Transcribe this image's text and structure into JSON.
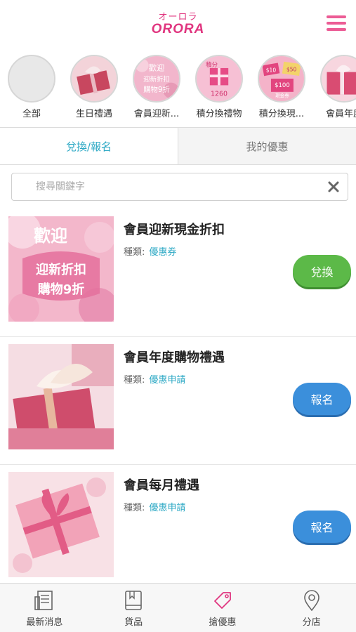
{
  "header": {
    "logo_kana": "オーロラ",
    "logo_main": "ORORA"
  },
  "categories": [
    {
      "label": "全部"
    },
    {
      "label": "生日禮遇"
    },
    {
      "label": "會員迎新..."
    },
    {
      "label": "積分換禮物"
    },
    {
      "label": "積分換現..."
    },
    {
      "label": "會員年度"
    }
  ],
  "category_thumbs": {
    "welcome": {
      "line1": "歡迎",
      "line2": "迎新折扣",
      "line3": "購物9折"
    },
    "points_gift": {
      "line1": "積分",
      "line2": "1260"
    },
    "points_cash": {
      "line1": "$10",
      "line2": "$50",
      "line3": "$100",
      "line4": "現金券"
    }
  },
  "tabs": {
    "redeem": "兌換/報名",
    "my_offers": "我的優惠"
  },
  "search": {
    "placeholder": "搜尋關鍵字"
  },
  "offers": [
    {
      "title": "會員迎新現金折扣",
      "type_label": "種類:",
      "type_value": "優惠券",
      "button": "兌換",
      "img": {
        "line1": "歡迎",
        "line2": "迎新折扣",
        "line3": "購物9折"
      }
    },
    {
      "title": "會員年度購物禮遇",
      "type_label": "種類:",
      "type_value": "優惠申請",
      "button": "報名"
    },
    {
      "title": "會員每月禮遇",
      "type_label": "種類:",
      "type_value": "優惠申請",
      "button": "報名"
    }
  ],
  "bottom_nav": [
    {
      "label": "最新消息",
      "icon": "newspaper-icon"
    },
    {
      "label": "貨品",
      "icon": "book-icon"
    },
    {
      "label": "搶優惠",
      "icon": "tag-icon",
      "active": true
    },
    {
      "label": "分店",
      "icon": "location-pin-icon"
    }
  ],
  "colors": {
    "brand": "#e0357f",
    "accent": "#2ba8c4",
    "green": "#5cb948",
    "blue": "#3b8fdb"
  }
}
